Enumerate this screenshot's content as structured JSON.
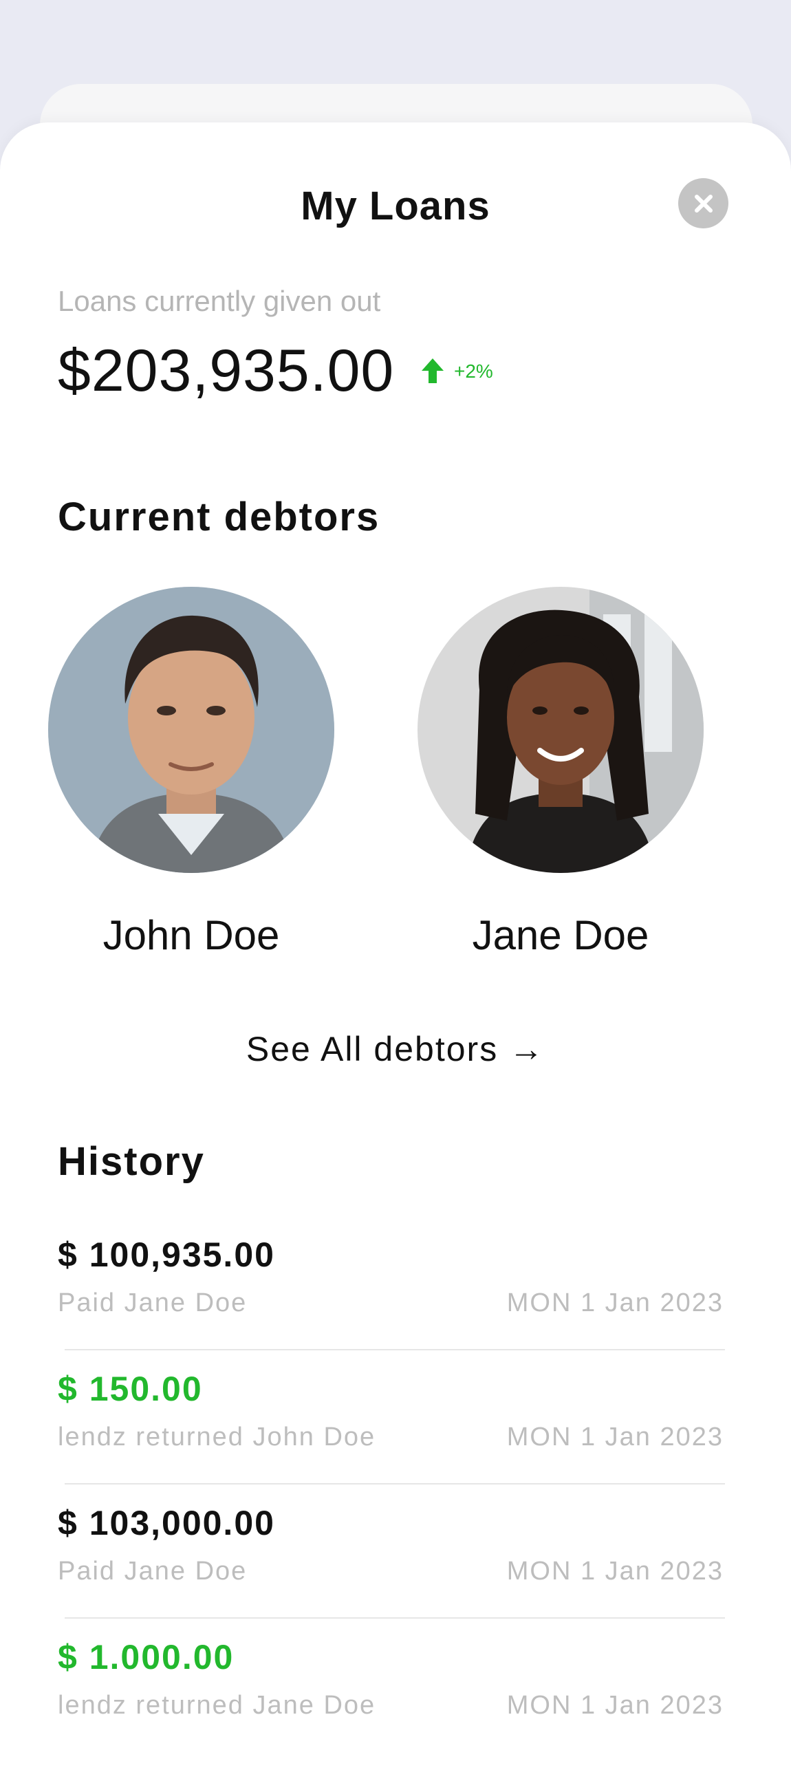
{
  "header": {
    "title": "My Loans",
    "close_icon": "close-icon"
  },
  "summary": {
    "label": "Loans currently given out",
    "amount": "$203,935.00",
    "trend": "+2%",
    "trend_icon": "arrow-up-icon",
    "trend_color": "#22b82d"
  },
  "debtors": {
    "title": "Current debtors",
    "items": [
      {
        "name": "John Doe",
        "avatar": "avatar-john-doe"
      },
      {
        "name": "Jane Doe",
        "avatar": "avatar-jane-doe"
      }
    ],
    "see_all": "See All debtors →"
  },
  "history": {
    "title": "History",
    "items": [
      {
        "amount": "$ 100,935.00",
        "description": "Paid Jane Doe",
        "date": "MON 1 Jan 2023",
        "color": "#111111"
      },
      {
        "amount": "$ 150.00",
        "description": "lendz returned John Doe",
        "date": "MON 1 Jan 2023",
        "color": "#22b82d"
      },
      {
        "amount": "$ 103,000.00",
        "description": "Paid Jane Doe",
        "date": "MON 1 Jan 2023",
        "color": "#111111"
      },
      {
        "amount": "$ 1.000.00",
        "description": "lendz returned Jane Doe",
        "date": "MON 1 Jan 2023",
        "color": "#22b82d"
      }
    ]
  }
}
